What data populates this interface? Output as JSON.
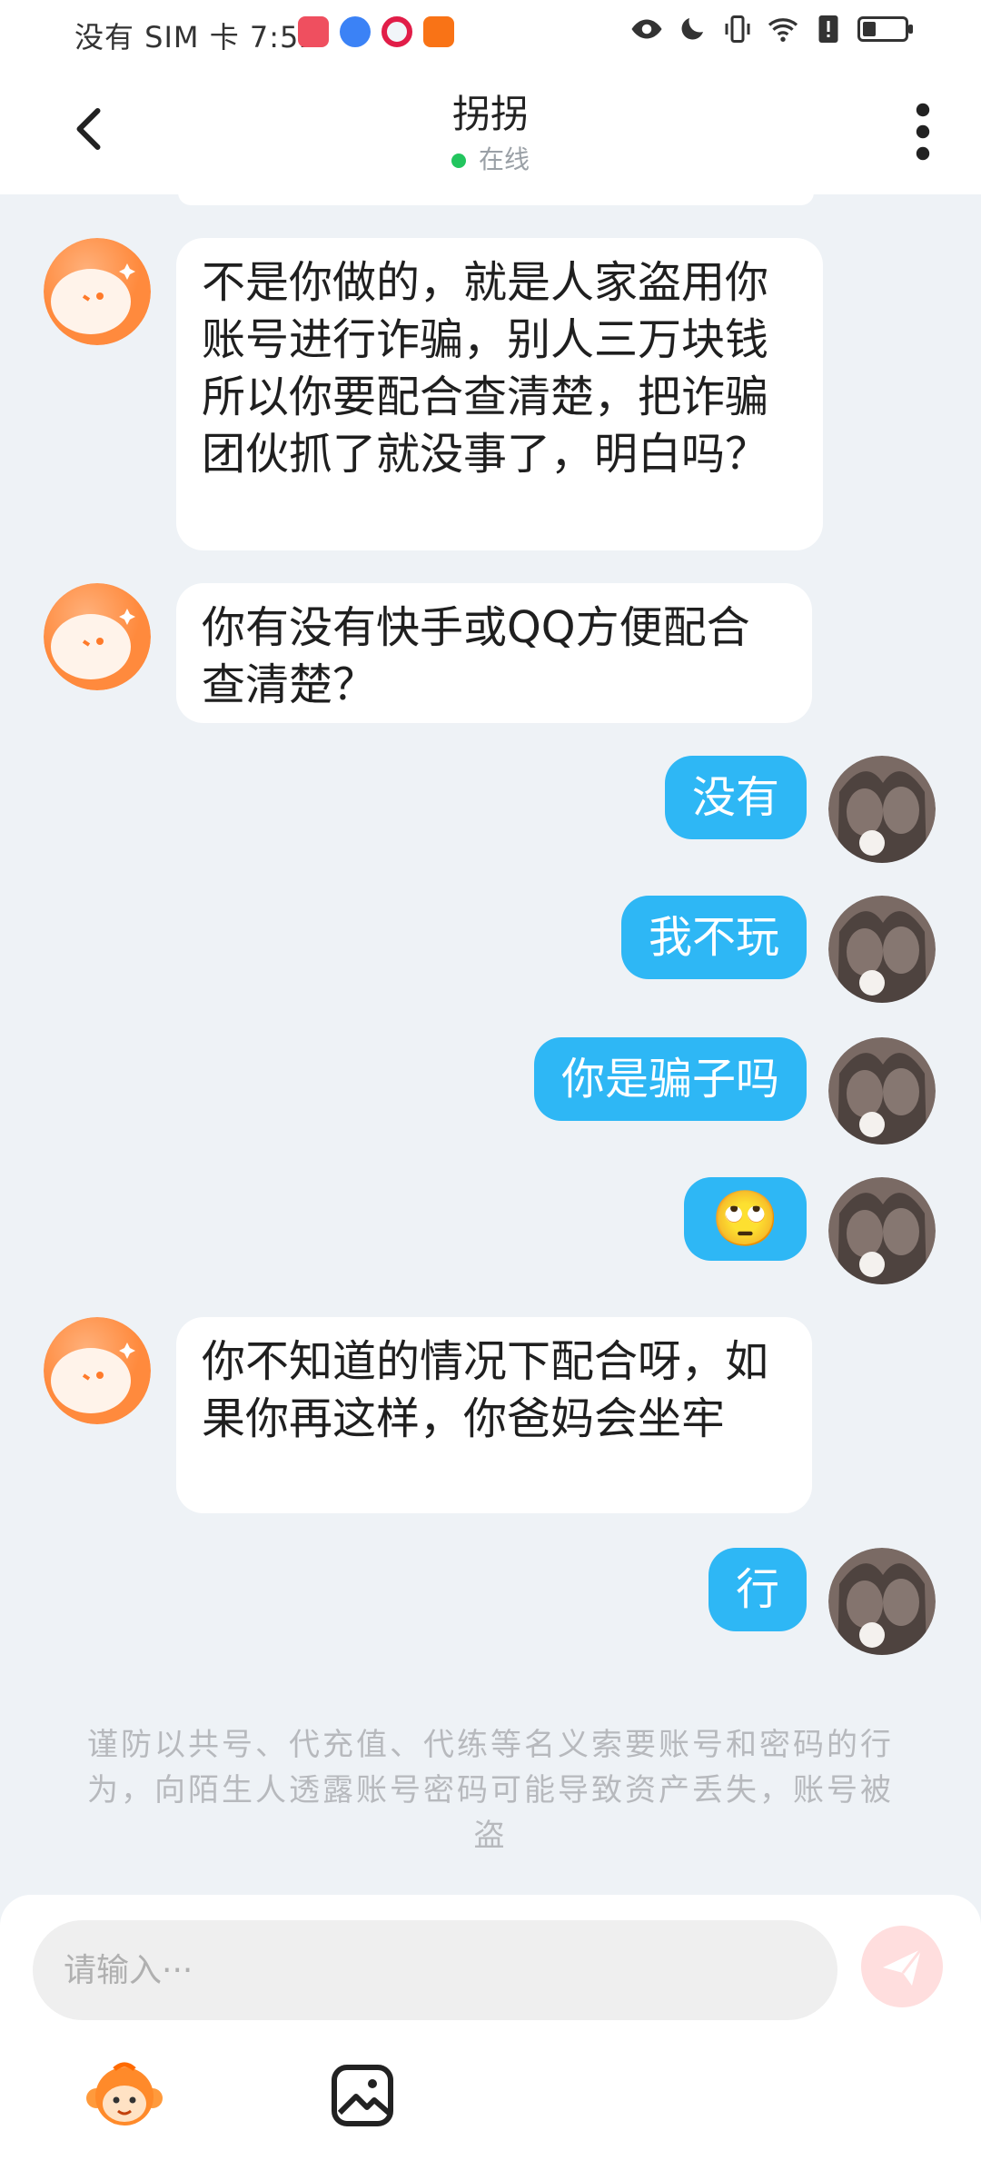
{
  "status_bar": {
    "carrier_time": "没有 SIM 卡 7:52"
  },
  "header": {
    "title": "拐拐",
    "status": "在线"
  },
  "messages": [
    {
      "side": "in",
      "text": "不是你做的，就是人家盗用你账号进行诈骗，别人三万块钱 所以你要配合查清楚，把诈骗团伙抓了就没事了，明白吗？"
    },
    {
      "side": "in",
      "text": "你有没有快手或QQ方便配合查清楚？"
    },
    {
      "side": "out",
      "text": "没有"
    },
    {
      "side": "out",
      "text": "我不玩"
    },
    {
      "side": "out",
      "text": "你是骗子吗"
    },
    {
      "side": "out",
      "text": "🙄"
    },
    {
      "side": "in",
      "text": "你不知道的情况下配合呀，如果你再这样，你爸妈会坐牢"
    },
    {
      "side": "out",
      "text": "行"
    }
  ],
  "notice": "谨防以共号、代充值、代练等名义索要账号和密码的行为，向陌生人透露账号密码可能导致资产丢失，账号被盗",
  "input": {
    "placeholder": "请输入···"
  },
  "colors": {
    "outgoing_bubble": "#2eb7f5",
    "incoming_bubble": "#ffffff",
    "online_dot": "#22c55e"
  }
}
